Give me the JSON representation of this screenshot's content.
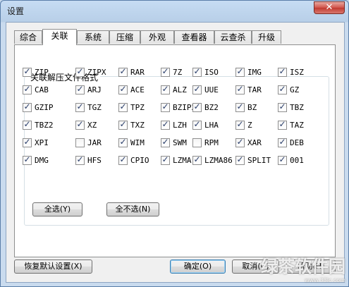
{
  "window": {
    "title": "设置",
    "close_label": "✕"
  },
  "tabs": [
    {
      "label": "综合",
      "active": false
    },
    {
      "label": "关联",
      "active": true
    },
    {
      "label": "系统",
      "active": false
    },
    {
      "label": "压缩",
      "active": false
    },
    {
      "label": "外观",
      "active": false
    },
    {
      "label": "查看器",
      "active": false
    },
    {
      "label": "云查杀",
      "active": false
    },
    {
      "label": "升级",
      "active": false
    }
  ],
  "group": {
    "title": "关联解压文件格式",
    "formats": [
      [
        {
          "label": "ZIP",
          "checked": true
        },
        {
          "label": "ZIPX",
          "checked": true
        },
        {
          "label": "RAR",
          "checked": true
        },
        {
          "label": "7Z",
          "checked": true
        },
        {
          "label": "ISO",
          "checked": true
        },
        {
          "label": "IMG",
          "checked": true
        },
        {
          "label": "ISZ",
          "checked": true
        }
      ],
      [
        {
          "label": "CAB",
          "checked": true
        },
        {
          "label": "ARJ",
          "checked": true
        },
        {
          "label": "ACE",
          "checked": true
        },
        {
          "label": "ALZ",
          "checked": true
        },
        {
          "label": "UUE",
          "checked": true
        },
        {
          "label": "TAR",
          "checked": true
        },
        {
          "label": "GZ",
          "checked": true
        }
      ],
      [
        {
          "label": "GZIP",
          "checked": true
        },
        {
          "label": "TGZ",
          "checked": true
        },
        {
          "label": "TPZ",
          "checked": true
        },
        {
          "label": "BZIP2",
          "checked": true
        },
        {
          "label": "BZ2",
          "checked": true
        },
        {
          "label": "BZ",
          "checked": true
        },
        {
          "label": "TBZ",
          "checked": true
        }
      ],
      [
        {
          "label": "TBZ2",
          "checked": true
        },
        {
          "label": "XZ",
          "checked": true
        },
        {
          "label": "TXZ",
          "checked": true
        },
        {
          "label": "LZH",
          "checked": true
        },
        {
          "label": "LHA",
          "checked": true
        },
        {
          "label": "Z",
          "checked": true
        },
        {
          "label": "TAZ",
          "checked": true
        }
      ],
      [
        {
          "label": "XPI",
          "checked": true
        },
        {
          "label": "JAR",
          "checked": false
        },
        {
          "label": "WIM",
          "checked": true
        },
        {
          "label": "SWM",
          "checked": true
        },
        {
          "label": "RPM",
          "checked": false
        },
        {
          "label": "XAR",
          "checked": true
        },
        {
          "label": "DEB",
          "checked": true
        }
      ],
      [
        {
          "label": "DMG",
          "checked": true
        },
        {
          "label": "HFS",
          "checked": true
        },
        {
          "label": "CPIO",
          "checked": true
        },
        {
          "label": "LZMA",
          "checked": true
        },
        {
          "label": "LZMA86",
          "checked": true
        },
        {
          "label": "SPLIT",
          "checked": true
        },
        {
          "label": "001",
          "checked": true
        }
      ]
    ],
    "select_all_label": "全选(Y)",
    "select_none_label": "全不选(N)"
  },
  "footer": {
    "restore_defaults_label": "恢复默认设置(X)",
    "ok_label": "确定(O)",
    "cancel_label": "取消(C)",
    "help_label": "帮助(H)"
  },
  "watermark": {
    "text": "绿茶软件园",
    "url": "www.33lc.com"
  },
  "checkmark": "✓"
}
